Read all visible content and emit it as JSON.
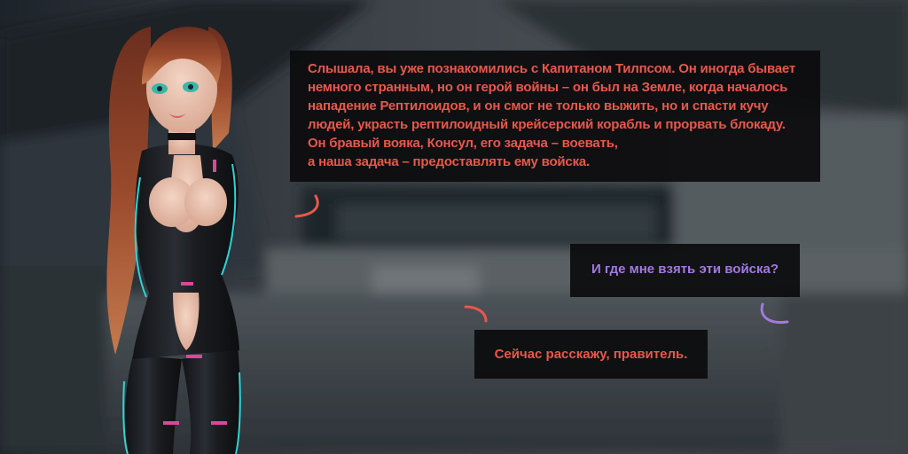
{
  "dialogue": [
    {
      "speaker": "npc",
      "lines": [
        "Слышала, вы уже познакомились с Капитаном Тилпсом. Он иногда бывает",
        "немного странным, но он герой войны – он был на Земле, когда началось",
        "нападение Рептилоидов, и он смог не только выжить, но и спасти кучу",
        "людей, украсть рептилоидный крейсерский корабль и прорвать блокаду.",
        "Он бравый вояка, Консул, его задача – воевать,",
        "а наша задача – предоставлять ему войска."
      ]
    },
    {
      "speaker": "player",
      "text": "И где мне взять эти войска?"
    },
    {
      "speaker": "npc",
      "text": "Сейчас расскажу, правитель."
    }
  ],
  "colors": {
    "npc_text": "#e8584a",
    "player_text": "#a479e0",
    "bubble_bg": "#0c0c0e",
    "npc_accent": "#e8584a",
    "player_accent": "#a479e0"
  },
  "character": {
    "icon": "advisor-portrait"
  }
}
